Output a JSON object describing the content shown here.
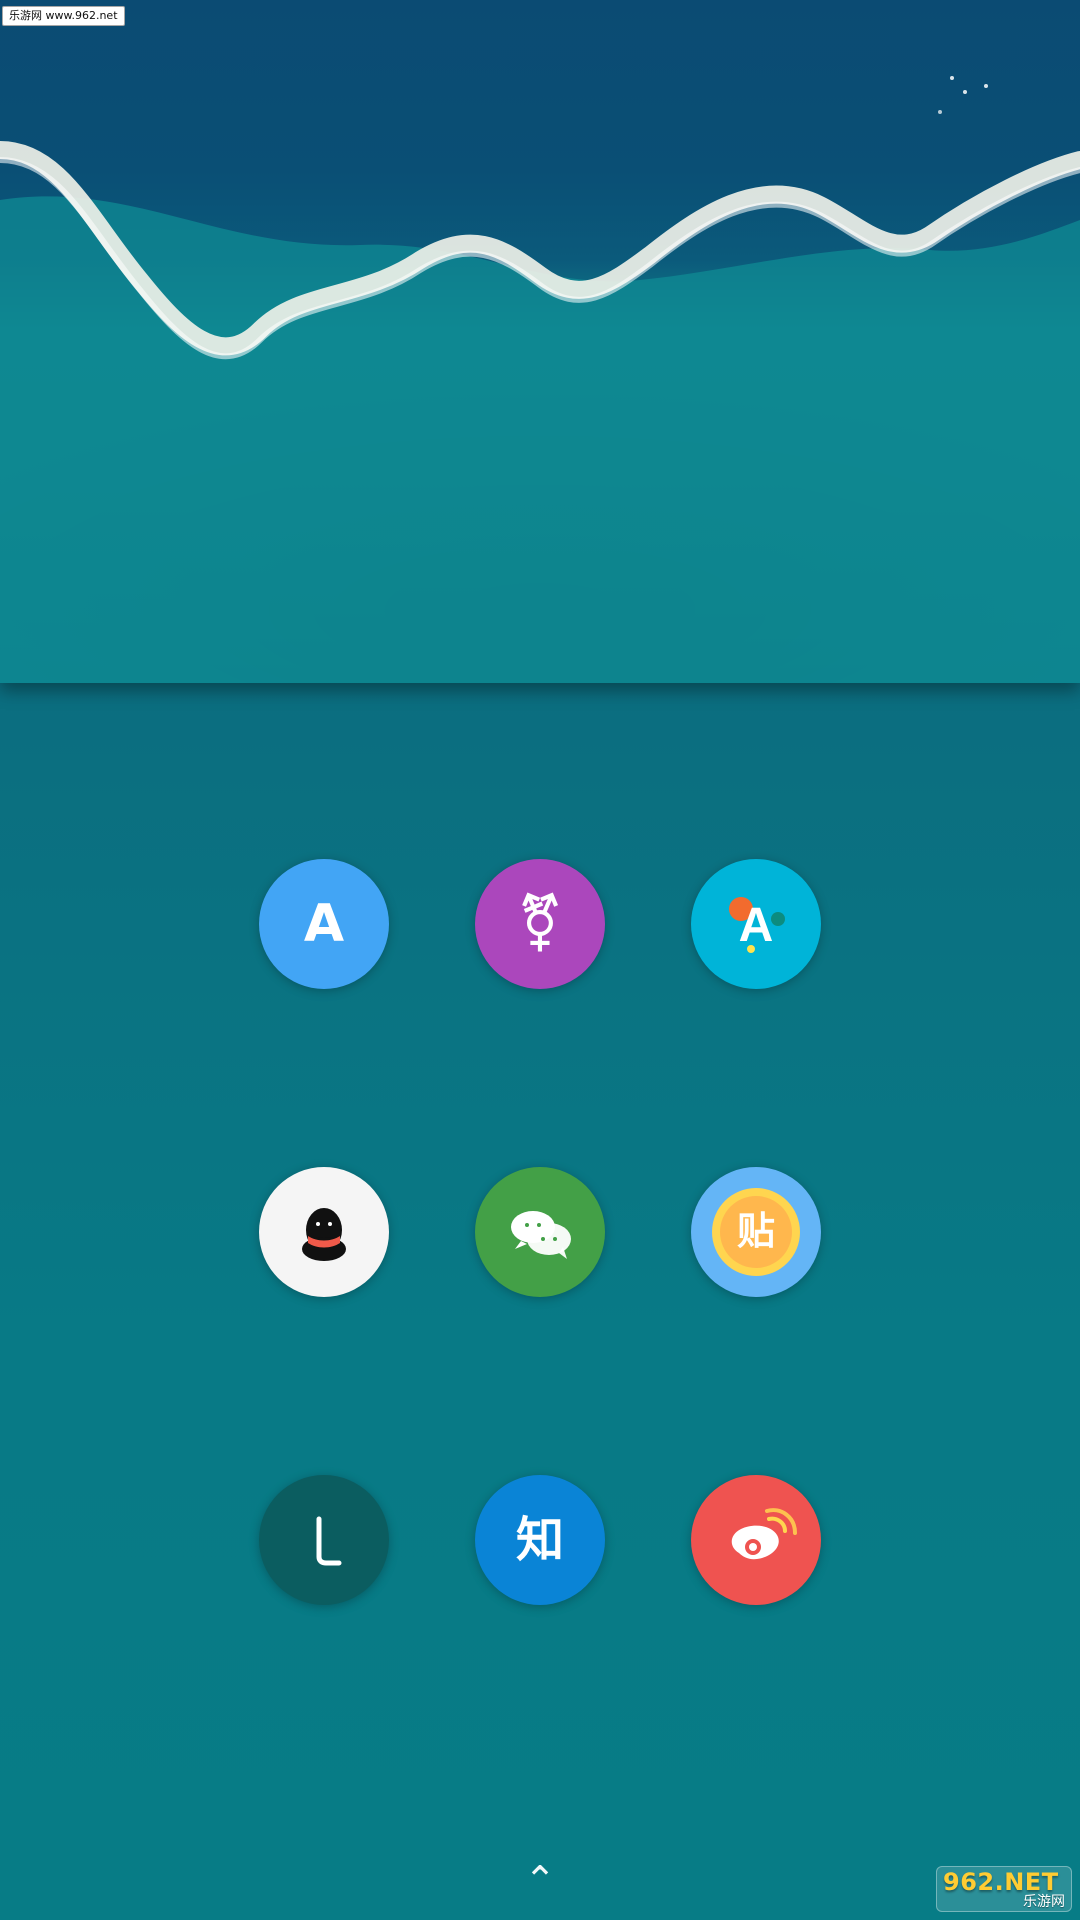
{
  "wallpaper": {
    "watermark_text": "乐游网 www.962.net"
  },
  "apps": [
    {
      "id": "translate",
      "label": "A",
      "icon_name": "translate-icon",
      "bg": "#42A5F5",
      "fg": "#FFFFFF"
    },
    {
      "id": "gender",
      "label": "⚧",
      "icon_name": "gender-symbol-icon",
      "bg": "#AB47BC",
      "fg": "#FFFFFF"
    },
    {
      "id": "font",
      "label": "A",
      "icon_name": "font-icon",
      "bg": "#00B4D8",
      "fg": "#FFFFFF"
    },
    {
      "id": "qq",
      "label": "",
      "icon_name": "qq-penguin-icon",
      "bg": "#F5F5F5",
      "fg": "#111111"
    },
    {
      "id": "wechat",
      "label": "",
      "icon_name": "wechat-bubbles-icon",
      "bg": "#43A047",
      "fg": "#FFFFFF"
    },
    {
      "id": "tieba",
      "label": "贴",
      "icon_name": "tieba-icon",
      "bg": "#64B5F6",
      "fg": "#FFFFFF"
    },
    {
      "id": "l-app",
      "label": "L",
      "icon_name": "l-letter-icon",
      "bg": "#0B5D60",
      "fg": "#FFFFFF"
    },
    {
      "id": "zhihu",
      "label": "知",
      "icon_name": "zhihu-icon",
      "bg": "#0A84D6",
      "fg": "#FFFFFF"
    },
    {
      "id": "weibo",
      "label": "",
      "icon_name": "weibo-icon",
      "bg": "#EF5350",
      "fg": "#FFFFFF"
    }
  ],
  "navigation": {
    "up_arrow_icon": "chevron-up-icon",
    "up_arrow_glyph": "⌃"
  },
  "watermark_bottom": {
    "line1": "962.NET",
    "line2": "乐游网"
  }
}
